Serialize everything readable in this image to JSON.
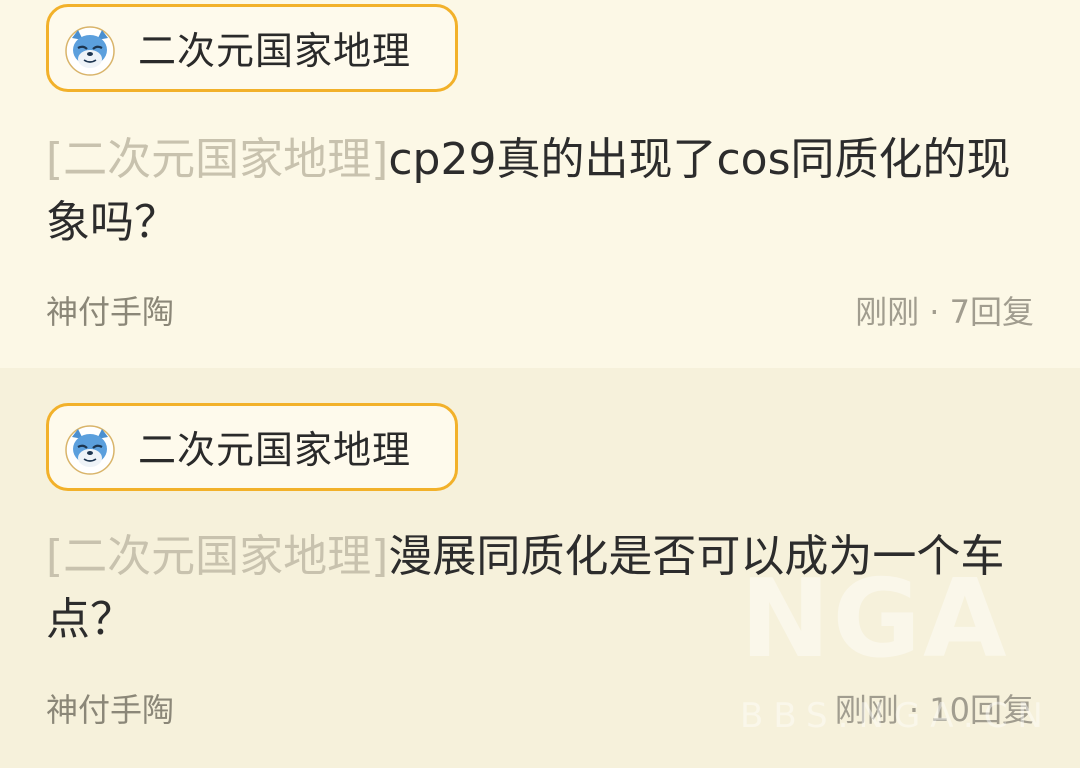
{
  "posts": [
    {
      "forum": "二次元国家地理",
      "title_tag": "[二次元国家地理]",
      "title": "cp29真的出现了cos同质化的现象吗？",
      "author": "神付手陶",
      "time": "刚刚",
      "separator": " · ",
      "replies": "7回复"
    },
    {
      "forum": "二次元国家地理",
      "title_tag": "[二次元国家地理]",
      "title": "漫展同质化是否可以成为一个车点？",
      "author": "神付手陶",
      "time": "刚刚",
      "separator": " · ",
      "replies": "10回复"
    }
  ],
  "watermark": {
    "logo": "NGA",
    "url": "BBS.NGA.CN"
  },
  "colors": {
    "chip_border": "#f2b12a",
    "first_bg": "#fcf8e6",
    "second_bg": "#f6f1db",
    "tag_text": "#c8c2ae"
  },
  "icons": {
    "forum_avatar": "cat-face-icon"
  }
}
